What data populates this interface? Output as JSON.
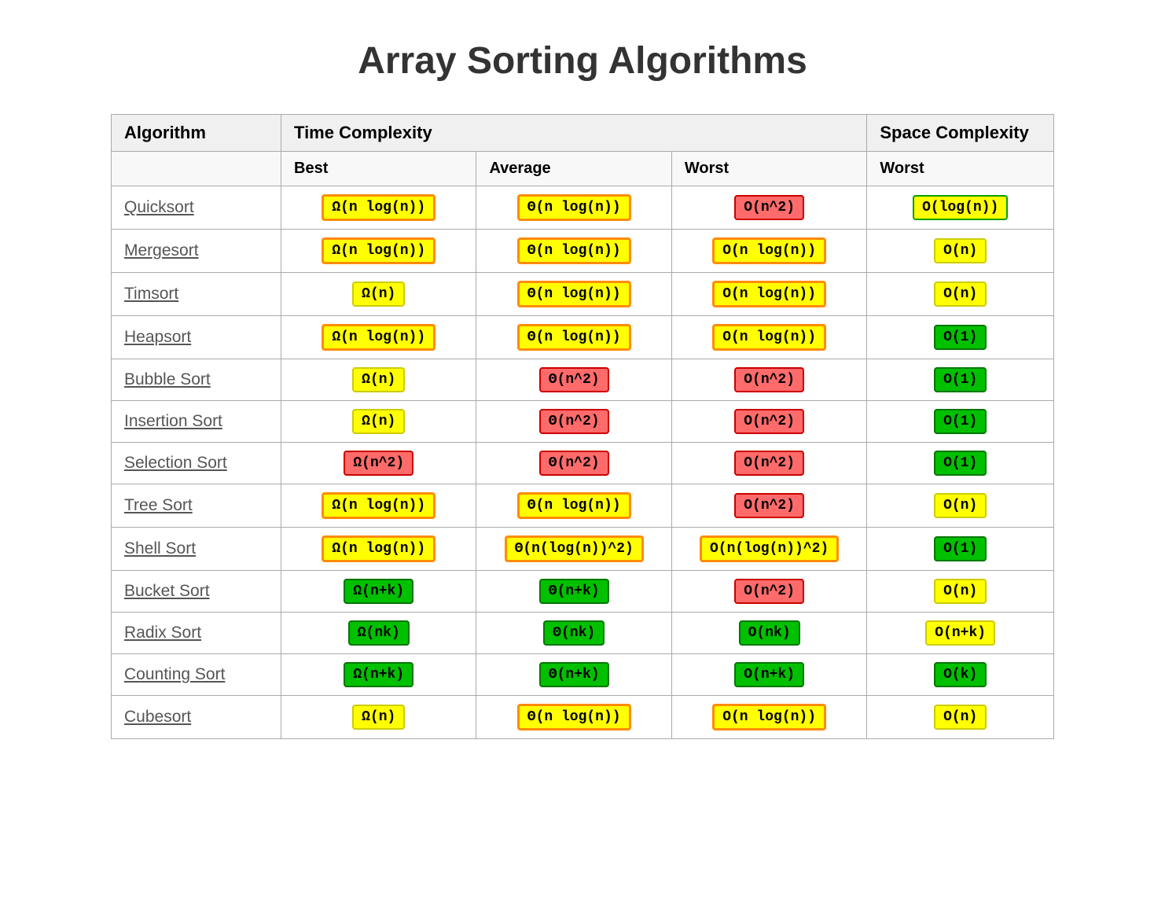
{
  "title": "Array Sorting Algorithms",
  "headers": {
    "algorithm": "Algorithm",
    "time_complexity": "Time Complexity",
    "space_complexity": "Space Complexity",
    "best": "Best",
    "average": "Average",
    "worst_time": "Worst",
    "worst_space": "Worst"
  },
  "rows": [
    {
      "name": "Quicksort",
      "best": {
        "text": "Ω(n log(n))",
        "style": "yellow-orange"
      },
      "average": {
        "text": "Θ(n log(n))",
        "style": "yellow-orange"
      },
      "worst": {
        "text": "O(n^2)",
        "style": "red-fill"
      },
      "space": {
        "text": "O(log(n))",
        "style": "yellow-green"
      }
    },
    {
      "name": "Mergesort",
      "best": {
        "text": "Ω(n log(n))",
        "style": "yellow-orange"
      },
      "average": {
        "text": "Θ(n log(n))",
        "style": "yellow-orange"
      },
      "worst": {
        "text": "O(n log(n))",
        "style": "yellow-orange"
      },
      "space": {
        "text": "O(n)",
        "style": "yellow-solid"
      }
    },
    {
      "name": "Timsort",
      "best": {
        "text": "Ω(n)",
        "style": "yellow-solid"
      },
      "average": {
        "text": "Θ(n log(n))",
        "style": "yellow-orange"
      },
      "worst": {
        "text": "O(n log(n))",
        "style": "yellow-orange"
      },
      "space": {
        "text": "O(n)",
        "style": "yellow-solid"
      }
    },
    {
      "name": "Heapsort",
      "best": {
        "text": "Ω(n log(n))",
        "style": "yellow-orange"
      },
      "average": {
        "text": "Θ(n log(n))",
        "style": "yellow-orange"
      },
      "worst": {
        "text": "O(n log(n))",
        "style": "yellow-orange"
      },
      "space": {
        "text": "O(1)",
        "style": "green-fill"
      }
    },
    {
      "name": "Bubble Sort",
      "best": {
        "text": "Ω(n)",
        "style": "yellow-solid"
      },
      "average": {
        "text": "Θ(n^2)",
        "style": "red-fill"
      },
      "worst": {
        "text": "O(n^2)",
        "style": "red-fill"
      },
      "space": {
        "text": "O(1)",
        "style": "green-fill"
      }
    },
    {
      "name": "Insertion Sort",
      "best": {
        "text": "Ω(n)",
        "style": "yellow-solid"
      },
      "average": {
        "text": "Θ(n^2)",
        "style": "red-fill"
      },
      "worst": {
        "text": "O(n^2)",
        "style": "red-fill"
      },
      "space": {
        "text": "O(1)",
        "style": "green-fill"
      }
    },
    {
      "name": "Selection Sort",
      "best": {
        "text": "Ω(n^2)",
        "style": "red-fill"
      },
      "average": {
        "text": "Θ(n^2)",
        "style": "red-fill"
      },
      "worst": {
        "text": "O(n^2)",
        "style": "red-fill"
      },
      "space": {
        "text": "O(1)",
        "style": "green-fill"
      }
    },
    {
      "name": "Tree Sort",
      "best": {
        "text": "Ω(n log(n))",
        "style": "yellow-orange"
      },
      "average": {
        "text": "Θ(n log(n))",
        "style": "yellow-orange"
      },
      "worst": {
        "text": "O(n^2)",
        "style": "red-fill"
      },
      "space": {
        "text": "O(n)",
        "style": "yellow-solid"
      }
    },
    {
      "name": "Shell Sort",
      "best": {
        "text": "Ω(n log(n))",
        "style": "yellow-orange"
      },
      "average": {
        "text": "Θ(n(log(n))^2)",
        "style": "yellow-orange"
      },
      "worst": {
        "text": "O(n(log(n))^2)",
        "style": "yellow-orange"
      },
      "space": {
        "text": "O(1)",
        "style": "green-fill"
      }
    },
    {
      "name": "Bucket Sort",
      "best": {
        "text": "Ω(n+k)",
        "style": "green-fill"
      },
      "average": {
        "text": "Θ(n+k)",
        "style": "green-fill"
      },
      "worst": {
        "text": "O(n^2)",
        "style": "red-fill"
      },
      "space": {
        "text": "O(n)",
        "style": "yellow-solid"
      }
    },
    {
      "name": "Radix Sort",
      "best": {
        "text": "Ω(nk)",
        "style": "green-fill"
      },
      "average": {
        "text": "Θ(nk)",
        "style": "green-fill"
      },
      "worst": {
        "text": "O(nk)",
        "style": "green-fill"
      },
      "space": {
        "text": "O(n+k)",
        "style": "yellow-solid"
      }
    },
    {
      "name": "Counting Sort",
      "best": {
        "text": "Ω(n+k)",
        "style": "green-fill"
      },
      "average": {
        "text": "Θ(n+k)",
        "style": "green-fill"
      },
      "worst": {
        "text": "O(n+k)",
        "style": "green-fill"
      },
      "space": {
        "text": "O(k)",
        "style": "green-fill"
      }
    },
    {
      "name": "Cubesort",
      "best": {
        "text": "Ω(n)",
        "style": "yellow-solid"
      },
      "average": {
        "text": "Θ(n log(n))",
        "style": "yellow-orange"
      },
      "worst": {
        "text": "O(n log(n))",
        "style": "yellow-orange"
      },
      "space": {
        "text": "O(n)",
        "style": "yellow-solid"
      }
    }
  ]
}
